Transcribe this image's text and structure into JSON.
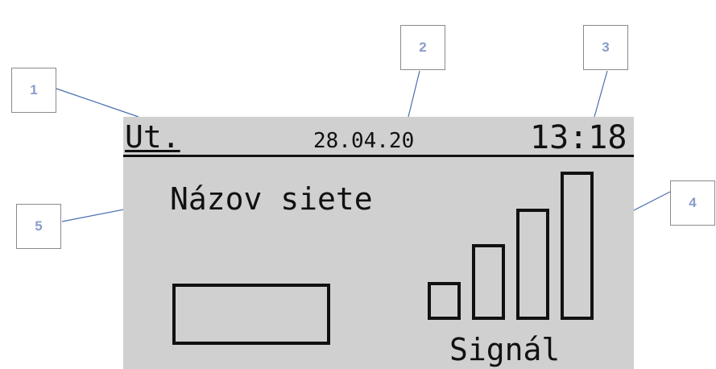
{
  "display": {
    "day": "Ut.",
    "date": "28.04.20",
    "time": "13:18",
    "network_label": "Názov siete",
    "signal_label": "Signál",
    "signal_bars_lit": 4,
    "background_color": "#d0d0d0"
  },
  "callouts": [
    "1",
    "2",
    "3",
    "4",
    "5"
  ],
  "colors": {
    "callout_text": "#8a9cc9",
    "leader_line": "#4a6fb0"
  }
}
